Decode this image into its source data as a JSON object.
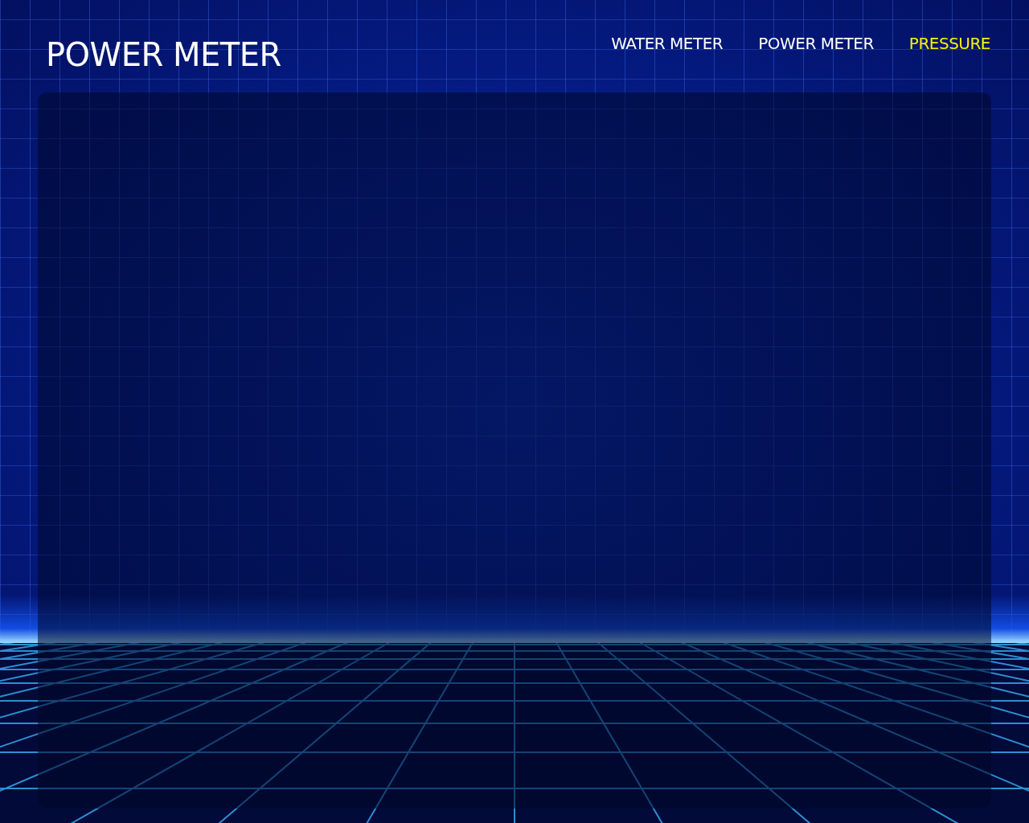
{
  "header": {
    "title": "POWER METER"
  },
  "nav": [
    {
      "label": "WATER METER",
      "selected": false
    },
    {
      "label": "POWER METER",
      "selected": false
    },
    {
      "label": "PRESSURE",
      "selected": true
    }
  ]
}
